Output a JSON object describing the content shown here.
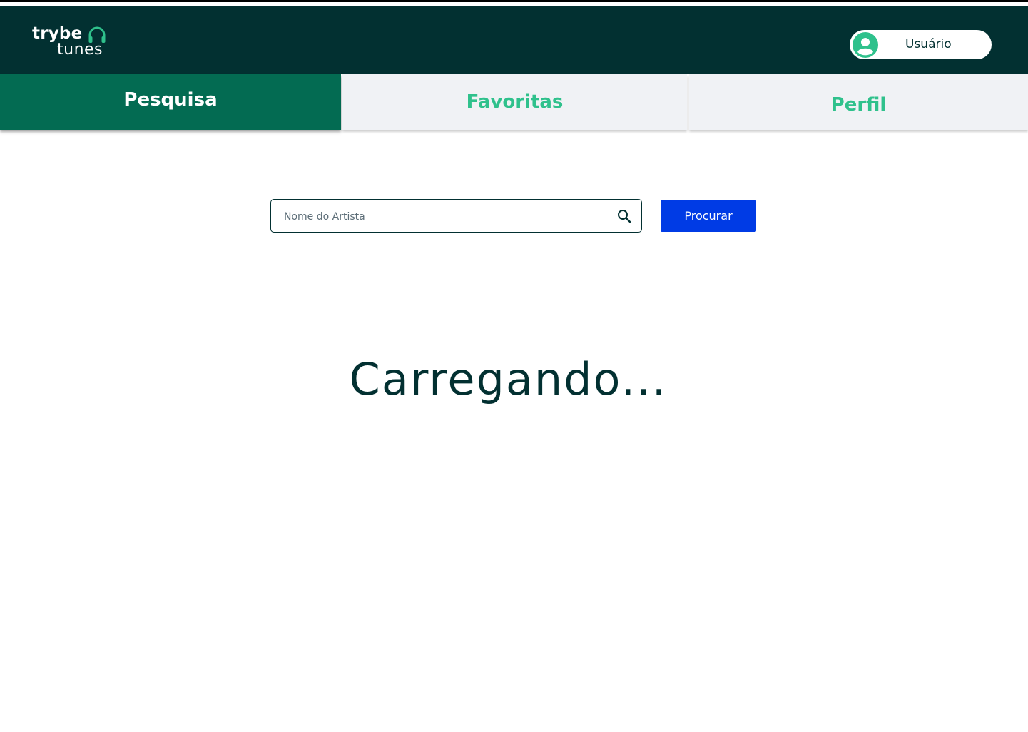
{
  "header": {
    "logo": {
      "line1": "trybe",
      "line2": "tunes",
      "icon": "headphones-icon"
    },
    "user": {
      "name": "Usuário",
      "avatar_icon": "user-circle-icon"
    }
  },
  "tabs": [
    {
      "label": "Pesquisa",
      "active": true
    },
    {
      "label": "Favoritas",
      "active": false
    },
    {
      "label": "Perfil",
      "active": false
    }
  ],
  "search": {
    "placeholder": "Nome do Artista",
    "value": "",
    "icon": "search-icon",
    "button_label": "Procurar"
  },
  "status": {
    "loading_text": "Carregando..."
  },
  "colors": {
    "header_bg": "#023031",
    "active_tab_bg": "#036b52",
    "inactive_tab_bg": "#f0f2f5",
    "accent_green": "#2fc18c",
    "button_blue": "#003be5"
  }
}
